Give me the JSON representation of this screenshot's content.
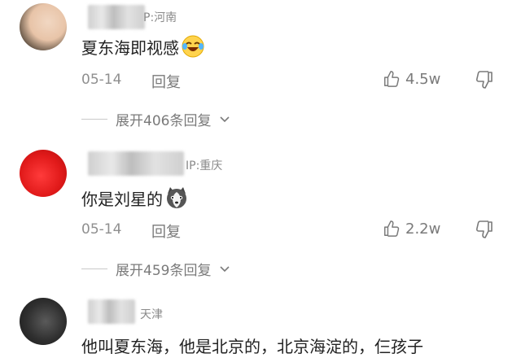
{
  "comments": [
    {
      "ip": "P:河南",
      "text": "夏东海即视感",
      "emoji": "laughing-crying-emoji",
      "date": "05-14",
      "reply_label": "回复",
      "likes": "4.5w",
      "expand_label": "展开406条回复"
    },
    {
      "ip": "IP:重庆",
      "text": "你是刘星的",
      "emoji": "husky-dog-emoji",
      "date": "05-14",
      "reply_label": "回复",
      "likes": "2.2w",
      "expand_label": "展开459条回复"
    },
    {
      "ip": "天津",
      "text": "他叫夏东海，他是北京的，北京海淀的，仨孩子"
    }
  ]
}
